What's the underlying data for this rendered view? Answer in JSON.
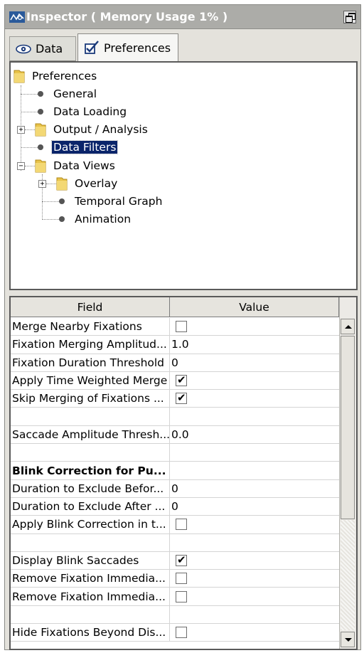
{
  "window": {
    "title": "Inspector ( Memory Usage 1% )",
    "icon": "eye-graph-icon",
    "float_icon": "float-window-icon"
  },
  "tabs": [
    {
      "label": "Data",
      "icon": "eye-icon",
      "active": false
    },
    {
      "label": "Preferences",
      "icon": "checkbox-pen-icon",
      "active": true
    }
  ],
  "tree": {
    "root": "Preferences",
    "items": {
      "general": "General",
      "data_loading": "Data Loading",
      "output_analysis": "Output / Analysis",
      "data_filters": "Data Filters",
      "data_views": "Data Views",
      "overlay": "Overlay",
      "temporal_graph": "Temporal Graph",
      "animation": "Animation"
    },
    "selected": "Data Filters"
  },
  "table": {
    "headers": {
      "field": "Field",
      "value": "Value"
    },
    "rows": [
      {
        "field": "Merge Nearby Fixations",
        "type": "checkbox",
        "checked": false
      },
      {
        "field": "Fixation Merging Amplitud...",
        "type": "text",
        "value": "1.0"
      },
      {
        "field": "Fixation Duration Threshold",
        "type": "text",
        "value": "0"
      },
      {
        "field": "Apply Time Weighted Merge",
        "type": "checkbox",
        "checked": true
      },
      {
        "field": "Skip Merging of Fixations ...",
        "type": "checkbox",
        "checked": true
      },
      {
        "field": "",
        "type": "empty"
      },
      {
        "field": "Saccade Amplitude Thresh...",
        "type": "text",
        "value": "0.0"
      },
      {
        "field": "",
        "type": "empty"
      },
      {
        "field": "Blink Correction for Pu...",
        "type": "header"
      },
      {
        "field": "Duration to Exclude Befor...",
        "type": "text",
        "value": "0"
      },
      {
        "field": "Duration to Exclude After ...",
        "type": "text",
        "value": "0"
      },
      {
        "field": "Apply Blink Correction in t...",
        "type": "checkbox",
        "checked": false
      },
      {
        "field": "",
        "type": "empty"
      },
      {
        "field": "Display Blink Saccades",
        "type": "checkbox",
        "checked": true
      },
      {
        "field": "Remove Fixation Immedia...",
        "type": "checkbox",
        "checked": false
      },
      {
        "field": "Remove Fixation Immedia...",
        "type": "checkbox",
        "checked": false
      },
      {
        "field": "",
        "type": "empty"
      },
      {
        "field": "Hide Fixations Beyond Dis...",
        "type": "checkbox",
        "checked": false
      }
    ]
  },
  "colors": {
    "titlebar": "#acaca8",
    "selection": "#0a246a",
    "panel_bg": "#e4e2dc",
    "folder": "#e8c34a"
  }
}
